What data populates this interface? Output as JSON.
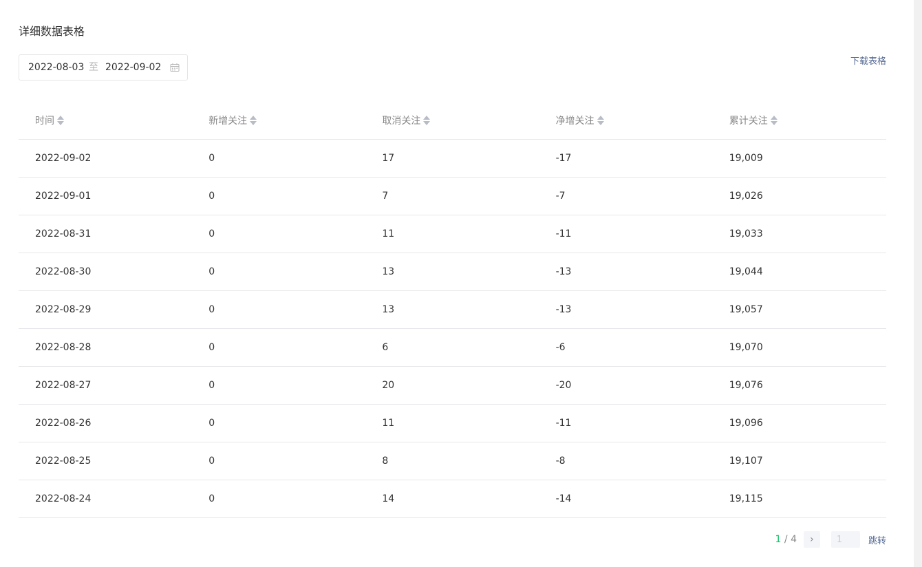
{
  "section": {
    "title": "详细数据表格"
  },
  "date_range": {
    "start": "2022-08-03",
    "separator": "至",
    "end": "2022-09-02",
    "icon": "calendar-icon"
  },
  "download": {
    "label": "下载表格"
  },
  "table": {
    "columns": [
      "时间",
      "新增关注",
      "取消关注",
      "净增关注",
      "累计关注"
    ],
    "rows": [
      [
        "2022-09-02",
        "0",
        "17",
        "-17",
        "19,009"
      ],
      [
        "2022-09-01",
        "0",
        "7",
        "-7",
        "19,026"
      ],
      [
        "2022-08-31",
        "0",
        "11",
        "-11",
        "19,033"
      ],
      [
        "2022-08-30",
        "0",
        "13",
        "-13",
        "19,044"
      ],
      [
        "2022-08-29",
        "0",
        "13",
        "-13",
        "19,057"
      ],
      [
        "2022-08-28",
        "0",
        "6",
        "-6",
        "19,070"
      ],
      [
        "2022-08-27",
        "0",
        "20",
        "-20",
        "19,076"
      ],
      [
        "2022-08-26",
        "0",
        "11",
        "-11",
        "19,096"
      ],
      [
        "2022-08-25",
        "0",
        "8",
        "-8",
        "19,107"
      ],
      [
        "2022-08-24",
        "0",
        "14",
        "-14",
        "19,115"
      ]
    ]
  },
  "pagination": {
    "current": "1",
    "separator": " / ",
    "total": "4",
    "next_icon": "chevron-right-icon",
    "input_value": "1",
    "jump_label": "跳转"
  },
  "colors": {
    "accent": "#07c160",
    "link": "#576b95",
    "border": "#e7e7eb"
  }
}
